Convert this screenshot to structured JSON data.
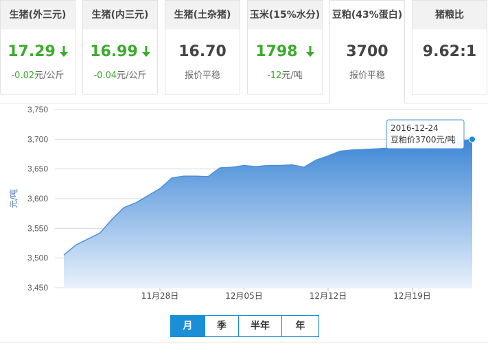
{
  "cards": [
    {
      "title": "生猪(外三元)",
      "value": "17.29",
      "sub_value": "-0.02",
      "sub_unit": "元/公斤",
      "trend": "down"
    },
    {
      "title": "生猪(内三元)",
      "value": "16.99",
      "sub_value": "-0.04",
      "sub_unit": "元/公斤",
      "trend": "down"
    },
    {
      "title": "生猪(土杂猪)",
      "value": "16.70",
      "sub_value": "",
      "sub_unit": "报价平稳",
      "trend": "flat"
    },
    {
      "title": "玉米(15%水分)",
      "value": "1798",
      "sub_value": "-12",
      "sub_unit": "元/吨",
      "trend": "down"
    },
    {
      "title": "豆粕(43%蛋白)",
      "value": "3700",
      "sub_value": "",
      "sub_unit": "报价平稳",
      "trend": "flat",
      "active": true
    },
    {
      "title": "猪粮比",
      "value": "9.62:1",
      "sub_value": "",
      "sub_unit": "",
      "trend": "flat"
    }
  ],
  "colors": {
    "down": "#3cab2c",
    "accent": "#1a8fd8",
    "series_line": "#4a90d9",
    "area_top": "#3d86d6",
    "area_bottom": "#e8f1fb"
  },
  "chart_data": {
    "type": "area",
    "ylabel": "元/吨",
    "ylim": [
      3450,
      3750
    ],
    "yticks": [
      "3,750",
      "3,700",
      "3,650",
      "3,600",
      "3,550",
      "3,500",
      "3,450"
    ],
    "ytick_values": [
      3750,
      3700,
      3650,
      3600,
      3550,
      3500,
      3450
    ],
    "xtick_labels": [
      "11月28日",
      "12月05日",
      "12月12日",
      "12月19日"
    ],
    "xtick_days": [
      -26,
      -19,
      -12,
      -5
    ],
    "x": [
      "2016-11-20",
      "2016-11-21",
      "2016-11-22",
      "2016-11-23",
      "2016-11-24",
      "2016-11-25",
      "2016-11-26",
      "2016-11-27",
      "2016-11-28",
      "2016-11-29",
      "2016-11-30",
      "2016-12-01",
      "2016-12-02",
      "2016-12-03",
      "2016-12-04",
      "2016-12-05",
      "2016-12-06",
      "2016-12-07",
      "2016-12-08",
      "2016-12-09",
      "2016-12-10",
      "2016-12-11",
      "2016-12-12",
      "2016-12-13",
      "2016-12-14",
      "2016-12-15",
      "2016-12-16",
      "2016-12-17",
      "2016-12-18",
      "2016-12-19",
      "2016-12-20",
      "2016-12-21",
      "2016-12-22",
      "2016-12-23",
      "2016-12-24"
    ],
    "values": [
      3505,
      3522,
      3532,
      3542,
      3565,
      3585,
      3593,
      3605,
      3617,
      3635,
      3638,
      3638,
      3637,
      3652,
      3653,
      3656,
      3654,
      3656,
      3656,
      3657,
      3653,
      3665,
      3672,
      3680,
      3682,
      3683,
      3684,
      3685,
      3686,
      3687,
      3688,
      3692,
      3694,
      3697,
      3700
    ],
    "grid": true,
    "tooltip": {
      "date": "2016-12-24",
      "label": "豆粕价3700元/吨"
    }
  },
  "tabs": [
    {
      "label": "月",
      "active": true
    },
    {
      "label": "季",
      "active": false
    },
    {
      "label": "半年",
      "active": false
    },
    {
      "label": "年",
      "active": false
    }
  ]
}
